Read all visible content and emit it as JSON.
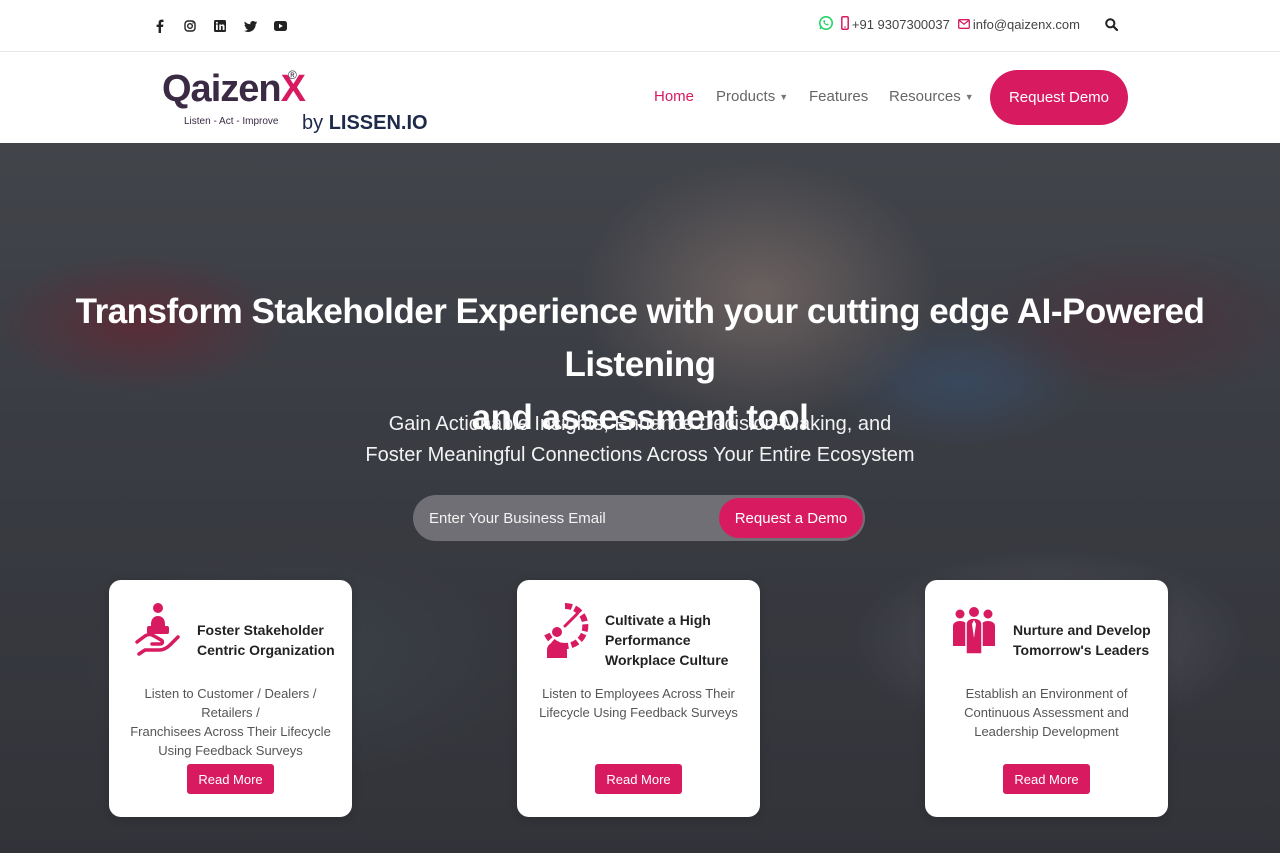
{
  "topbar": {
    "social": [
      {
        "icon": "facebook-icon",
        "glyph": "f"
      },
      {
        "icon": "instagram-icon",
        "glyph": "◎"
      },
      {
        "icon": "linkedin-icon",
        "glyph": "in"
      },
      {
        "icon": "twitter-icon",
        "glyph": "t"
      },
      {
        "icon": "youtube-icon",
        "glyph": "▶"
      }
    ],
    "phone": "+91 9307300037",
    "email": "info@qaizenx.com"
  },
  "header": {
    "logo": {
      "wordmark": "Qaizen",
      "wordmark_x": "X",
      "registered": "®",
      "tagline": "Listen - Act - Improve",
      "by": "by",
      "company": "LISSEN.IO"
    },
    "nav": [
      {
        "label": "Home",
        "active": true,
        "dropdown": false
      },
      {
        "label": "Products",
        "active": false,
        "dropdown": true
      },
      {
        "label": "Features",
        "active": false,
        "dropdown": false
      },
      {
        "label": "Resources",
        "active": false,
        "dropdown": true
      }
    ],
    "cta": "Request Demo"
  },
  "hero": {
    "title_line1": "Transform Stakeholder Experience with your cutting edge AI-Powered Listening",
    "title_line2": "and assessment tool",
    "subtitle_line1": "Gain Actionable Insights, Enhance Decision-Making, and",
    "subtitle_line2": "Foster Meaningful Connections Across Your Entire Ecosystem",
    "email_placeholder": "Enter Your Business Email",
    "submit": "Request a Demo"
  },
  "cards": [
    {
      "icon": "customer-care-icon",
      "title": [
        "Foster Stakeholder",
        "Centric Organization"
      ],
      "description": [
        "Listen to Customer / Dealers / Retailers /",
        "Franchisees Across Their Lifecycle",
        "Using Feedback Surveys"
      ],
      "button": "Read More"
    },
    {
      "icon": "performance-gauge-icon",
      "title": [
        "Cultivate a High",
        "Performance",
        "Workplace Culture"
      ],
      "description": [
        "Listen to Employees Across Their",
        "Lifecycle Using Feedback Surveys"
      ],
      "button": "Read More"
    },
    {
      "icon": "leaders-group-icon",
      "title": [
        "Nurture and Develop",
        "Tomorrow's Leaders"
      ],
      "description": [
        "Establish an Environment of",
        "Continuous Assessment and",
        "Leadership Development"
      ],
      "button": "Read More"
    }
  ],
  "colors": {
    "accent": "#d81b60",
    "dark": "#3b2a44",
    "whatsapp": "#25d366"
  }
}
